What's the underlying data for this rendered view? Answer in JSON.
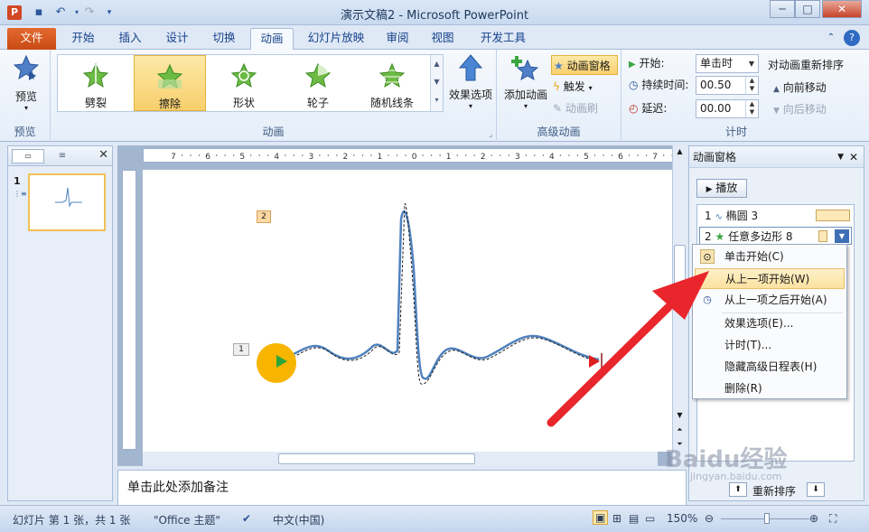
{
  "window": {
    "title": "演示文稿2 - Microsoft PowerPoint",
    "min": "─",
    "max": "□",
    "close": "✕"
  },
  "tabs": [
    "文件",
    "开始",
    "插入",
    "设计",
    "切换",
    "动画",
    "幻灯片放映",
    "审阅",
    "视图",
    "开发工具"
  ],
  "active_tab": "动画",
  "ribbon": {
    "preview_group": {
      "button": "预览",
      "label": "预览"
    },
    "animation_group": {
      "label": "动画",
      "effects": [
        "劈裂",
        "擦除",
        "形状",
        "轮子",
        "随机线条"
      ],
      "selected": "擦除",
      "effect_options": "效果选项"
    },
    "advanced_group": {
      "label": "高级动画",
      "add_animation": "添加动画",
      "animation_pane": "动画窗格",
      "trigger": "触发",
      "animation_painter": "动画刷"
    },
    "timing_group": {
      "label": "计时",
      "start_label": "开始:",
      "start_value": "单击时",
      "duration_label": "持续时间:",
      "duration_value": "00.50",
      "delay_label": "延迟:",
      "delay_value": "00.00",
      "reorder_title": "对动画重新排序",
      "move_earlier": "向前移动",
      "move_later": "向后移动"
    }
  },
  "ruler": [
    "7",
    "6",
    "5",
    "4",
    "3",
    "2",
    "1",
    "0",
    "1",
    "2",
    "3",
    "4",
    "5",
    "6",
    "7"
  ],
  "slides": {
    "number": "1"
  },
  "slide": {
    "tag1": "1",
    "tag2": "2"
  },
  "notes": {
    "placeholder": "单击此处添加备注"
  },
  "animation_pane": {
    "title": "动画窗格",
    "play": "播放",
    "items": [
      {
        "num": "1",
        "name": "椭圆 3"
      },
      {
        "num": "2",
        "name": "任意多边形 8"
      }
    ],
    "reorder": "重新排序"
  },
  "context_menu": {
    "items": [
      "单击开始(C)",
      "从上一项开始(W)",
      "从上一项之后开始(A)",
      "效果选项(E)...",
      "计时(T)...",
      "隐藏高级日程表(H)",
      "删除(R)"
    ],
    "highlighted": "从上一项开始(W)"
  },
  "status": {
    "slide_info": "幻灯片 第 1 张，共 1 张",
    "theme": "\"Office 主题\"",
    "language": "中文(中国)",
    "zoom": "150%"
  },
  "watermark": {
    "main": "Baidu经验",
    "sub": "jingyan.baidu.com"
  },
  "colors": {
    "accent": "#d04a14",
    "arrow": "#e8262c",
    "circle": "#f7b500",
    "ecg_line": "#4f81bd"
  }
}
